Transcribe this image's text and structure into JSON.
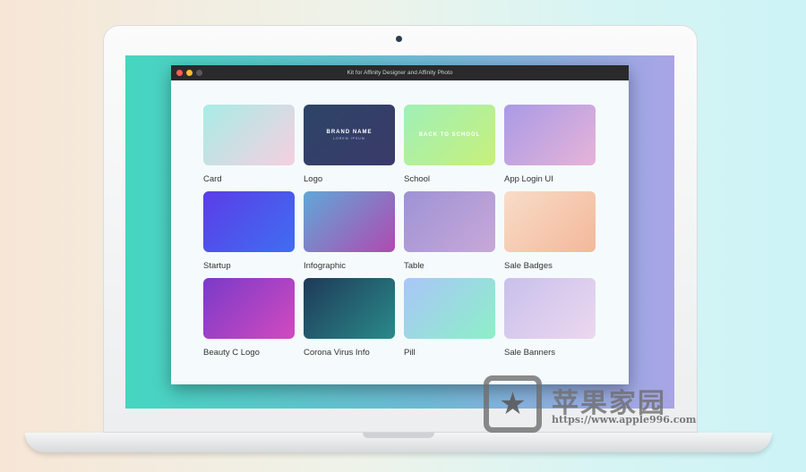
{
  "window": {
    "title": "Kit for Affinity Designer and Affinity Photo"
  },
  "traffic_lights": {
    "close": "#ff5f57",
    "minimize": "#febc2e",
    "zoom": "#5a5a5c"
  },
  "templates": [
    {
      "label": "Card",
      "gradient": [
        "#a8ece6",
        "#f6cfe0"
      ]
    },
    {
      "label": "Logo",
      "gradient": [
        "#2d4466",
        "#3a3a6a"
      ],
      "thumb_title": "BRAND NAME",
      "thumb_sub": "LOREM IPSUM"
    },
    {
      "label": "School",
      "gradient": [
        "#9ff0b8",
        "#c8f07a"
      ],
      "thumb_title": "BACK TO SCHOOL"
    },
    {
      "label": "App Login UI",
      "gradient": [
        "#a99ae6",
        "#e6b4d8"
      ]
    },
    {
      "label": "Startup",
      "gradient": [
        "#5b3de8",
        "#3f6ef0"
      ]
    },
    {
      "label": "Infographic",
      "gradient": [
        "#5fa8d8",
        "#b04ab0"
      ]
    },
    {
      "label": "Table",
      "gradient": [
        "#9d93d6",
        "#c8a8d8"
      ]
    },
    {
      "label": "Sale Badges",
      "gradient": [
        "#f8dcc8",
        "#f3b89a"
      ]
    },
    {
      "label": "Beauty C Logo",
      "gradient": [
        "#7a3ac8",
        "#d24ac0"
      ]
    },
    {
      "label": "Corona Virus Info",
      "gradient": [
        "#1e3a58",
        "#2a8a8a"
      ]
    },
    {
      "label": "Pill",
      "gradient": [
        "#a9c6f8",
        "#8cf0c8"
      ]
    },
    {
      "label": "Sale Banners",
      "gradient": [
        "#c8c0ec",
        "#ecd8ee"
      ]
    }
  ],
  "watermark": {
    "text": "苹果家园",
    "url": "https://www.apple996.com"
  }
}
